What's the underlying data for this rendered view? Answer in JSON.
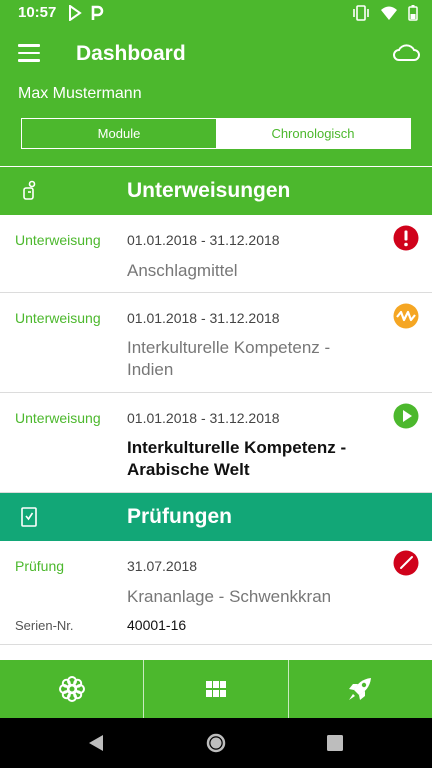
{
  "status_bar": {
    "time": "10:57"
  },
  "app_bar": {
    "title": "Dashboard",
    "user_name": "Max Mustermann"
  },
  "segments": {
    "module": "Module",
    "chrono": "Chronologisch",
    "selected": "Module"
  },
  "sections": {
    "unterweisungen": {
      "title": "Unterweisungen"
    },
    "pruefungen": {
      "title": "Prüfungen"
    }
  },
  "unterweisungen_items": [
    {
      "type": "Unterweisung",
      "date": "01.01.2018 - 31.12.2018",
      "title": "Anschlagmittel",
      "status_icon": "alert-icon",
      "status_color": "#d0021b"
    },
    {
      "type": "Unterweisung",
      "date": "01.01.2018 - 31.12.2018",
      "title": "Interkulturelle Kompetenz - Indien",
      "status_icon": "in-progress-icon",
      "status_color": "#f5a623"
    },
    {
      "type": "Unterweisung",
      "date": "01.01.2018 - 31.12.2018",
      "title": "Interkulturelle Kompetenz - Arabische Welt",
      "status_icon": "play-icon",
      "status_color": "#4cb82d"
    }
  ],
  "pruefungen_items": [
    {
      "type": "Prüfung",
      "date": "31.07.2018",
      "title": "Krananlage - Schwenkkran",
      "serial_label": "Serien-Nr.",
      "serial_value": "40001-16",
      "status_icon": "clock-icon",
      "status_color": "#d0021b"
    }
  ],
  "bottom_nav": [
    {
      "name": "flower-icon"
    },
    {
      "name": "grid-icon"
    },
    {
      "name": "rocket-icon"
    }
  ],
  "colors": {
    "primary": "#4cb82d",
    "teal": "#12a777",
    "alert": "#d0021b",
    "warning": "#f5a623"
  }
}
